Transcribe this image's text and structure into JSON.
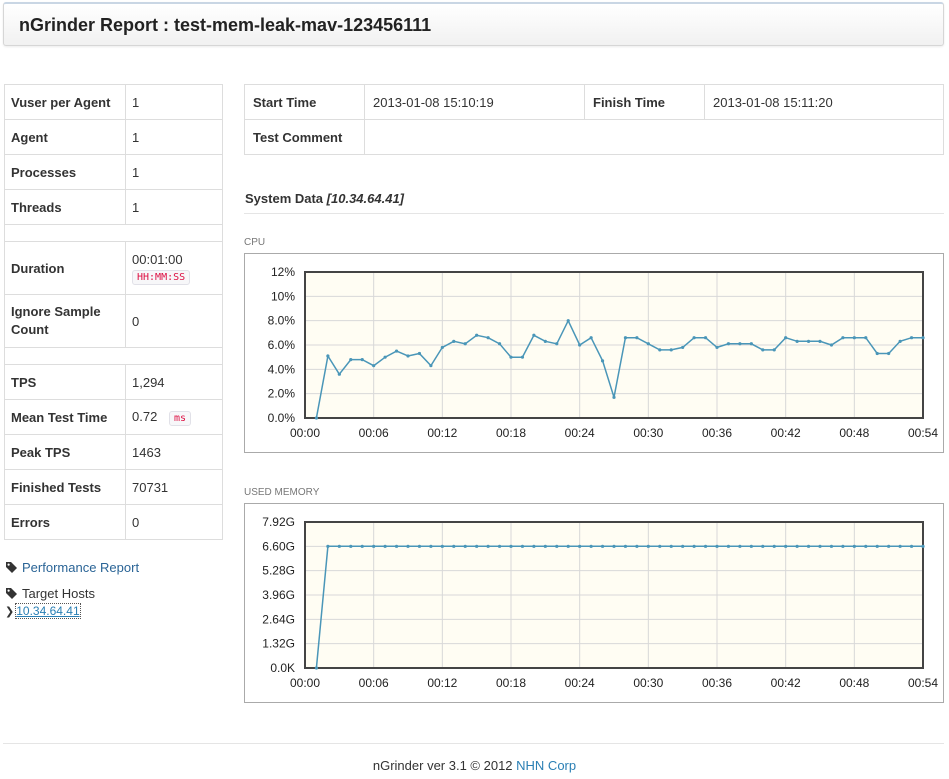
{
  "header": {
    "title": "nGrinder Report : test-mem-leak-mav-123456111"
  },
  "summary": {
    "vuser_label": "Vuser per Agent",
    "vuser_value": "1",
    "agent_label": "Agent",
    "agent_value": "1",
    "processes_label": "Processes",
    "processes_value": "1",
    "threads_label": "Threads",
    "threads_value": "1",
    "duration_label": "Duration",
    "duration_value": "00:01:00",
    "duration_unit": "HH:MM:SS",
    "ignore_label": "Ignore Sample Count",
    "ignore_value": "0",
    "tps_label": "TPS",
    "tps_value": "1,294",
    "mtt_label": "Mean Test Time",
    "mtt_value": "0.72",
    "mtt_unit": "ms",
    "peak_label": "Peak TPS",
    "peak_value": "1463",
    "finished_label": "Finished Tests",
    "finished_value": "70731",
    "errors_label": "Errors",
    "errors_value": "0"
  },
  "sidebar": {
    "performance_report": "Performance Report",
    "target_hosts": "Target Hosts",
    "host": "10.34.64.41"
  },
  "test_info": {
    "start_label": "Start Time",
    "start_value": "2013-01-08 15:10:19",
    "finish_label": "Finish Time",
    "finish_value": "2013-01-08 15:11:20",
    "comment_label": "Test Comment",
    "comment_value": ""
  },
  "system_data": {
    "title": "System Data",
    "host": "[10.34.64.41]"
  },
  "footer": {
    "prefix": "nGrinder ver 3.1 © 2012 ",
    "company": "NHN Corp"
  },
  "colors": {
    "line": "#4a96b8",
    "plot_bg": "#fffdf3",
    "grid": "#d8d8d8",
    "link": "#3a87ad"
  },
  "chart_data": [
    {
      "type": "line",
      "title": "CPU",
      "x_ticks": [
        "00:00",
        "00:06",
        "00:12",
        "00:18",
        "00:24",
        "00:30",
        "00:36",
        "00:42",
        "00:48",
        "00:54"
      ],
      "y_ticks": [
        "0.0%",
        "2.0%",
        "4.0%",
        "6.0%",
        "8.0%",
        "10%",
        "12%"
      ],
      "ylim": [
        0,
        12
      ],
      "x": [
        1,
        2,
        3,
        4,
        5,
        6,
        7,
        8,
        9,
        10,
        11,
        12,
        13,
        14,
        15,
        16,
        17,
        18,
        19,
        20,
        21,
        22,
        23,
        24,
        25,
        26,
        27,
        28,
        29,
        30,
        31,
        32,
        33,
        34,
        35,
        36,
        37,
        38,
        39,
        40,
        41,
        42,
        43,
        44,
        45,
        46,
        47,
        48,
        49,
        50,
        51,
        52,
        53,
        54
      ],
      "y": [
        0.0,
        5.1,
        3.6,
        4.8,
        4.8,
        4.3,
        5.0,
        5.5,
        5.1,
        5.3,
        4.3,
        5.8,
        6.3,
        6.1,
        6.8,
        6.6,
        6.1,
        5.0,
        5.0,
        6.8,
        6.3,
        6.1,
        8.0,
        6.0,
        6.6,
        4.7,
        1.7,
        6.6,
        6.6,
        6.1,
        5.6,
        5.6,
        5.8,
        6.6,
        6.6,
        5.8,
        6.1,
        6.1,
        6.1,
        5.6,
        5.6,
        6.6,
        6.3,
        6.3,
        6.3,
        6.0,
        6.6,
        6.6,
        6.6,
        5.3,
        5.3,
        6.3,
        6.6,
        6.6
      ],
      "series": [
        {
          "name": ""
        }
      ]
    },
    {
      "type": "line",
      "title": "USED MEMORY",
      "x_ticks": [
        "00:00",
        "00:06",
        "00:12",
        "00:18",
        "00:24",
        "00:30",
        "00:36",
        "00:42",
        "00:48",
        "00:54"
      ],
      "y_ticks": [
        "0.0K",
        "1.32G",
        "2.64G",
        "3.96G",
        "5.28G",
        "6.60G",
        "7.92G"
      ],
      "ylim": [
        0,
        7.92
      ],
      "x": [
        1,
        2,
        3,
        4,
        5,
        6,
        7,
        8,
        9,
        10,
        11,
        12,
        13,
        14,
        15,
        16,
        17,
        18,
        19,
        20,
        21,
        22,
        23,
        24,
        25,
        26,
        27,
        28,
        29,
        30,
        31,
        32,
        33,
        34,
        35,
        36,
        37,
        38,
        39,
        40,
        41,
        42,
        43,
        44,
        45,
        46,
        47,
        48,
        49,
        50,
        51,
        52,
        53,
        54
      ],
      "y": [
        0.0,
        6.6,
        6.6,
        6.6,
        6.6,
        6.6,
        6.6,
        6.6,
        6.6,
        6.6,
        6.6,
        6.6,
        6.6,
        6.6,
        6.6,
        6.6,
        6.6,
        6.6,
        6.6,
        6.6,
        6.6,
        6.6,
        6.6,
        6.6,
        6.6,
        6.6,
        6.6,
        6.6,
        6.6,
        6.6,
        6.6,
        6.6,
        6.6,
        6.6,
        6.6,
        6.6,
        6.6,
        6.6,
        6.6,
        6.6,
        6.6,
        6.6,
        6.6,
        6.6,
        6.6,
        6.6,
        6.6,
        6.6,
        6.6,
        6.6,
        6.6,
        6.6,
        6.6,
        6.6
      ],
      "series": [
        {
          "name": ""
        }
      ]
    }
  ]
}
